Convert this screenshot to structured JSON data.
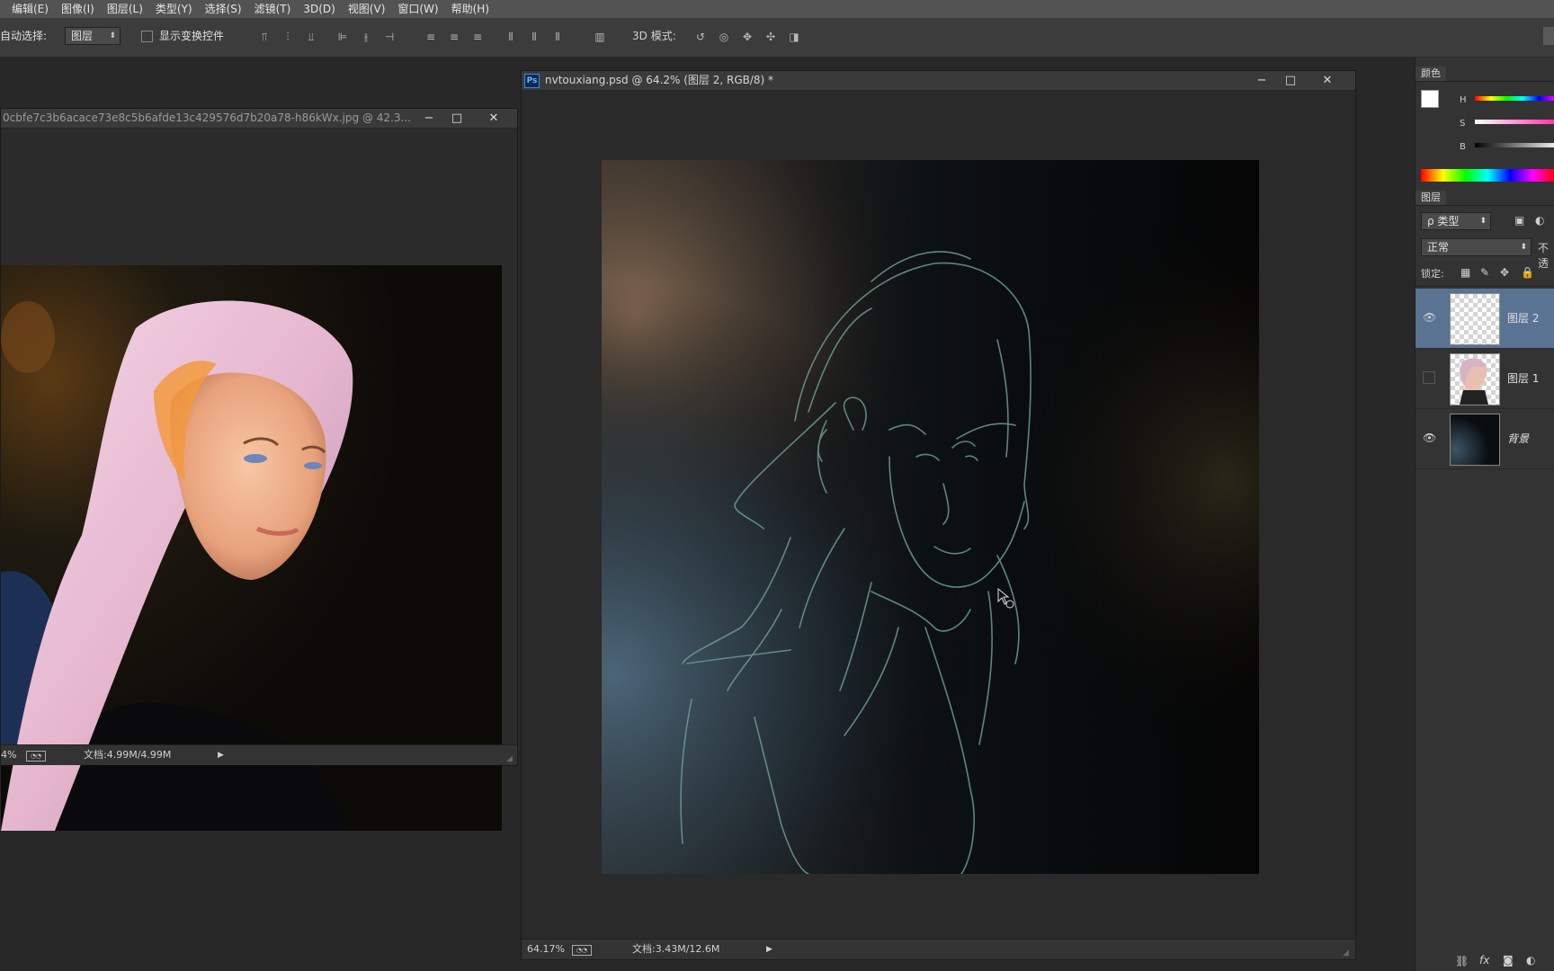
{
  "menu": [
    "编辑(E)",
    "图像(I)",
    "图层(L)",
    "类型(Y)",
    "选择(S)",
    "滤镜(T)",
    "3D(D)",
    "视图(V)",
    "窗口(W)",
    "帮助(H)"
  ],
  "options": {
    "auto_select_label": "自动选择:",
    "auto_select_value": "图层",
    "transform_label": "显示变换控件",
    "mode_3d_label": "3D 模式:"
  },
  "doc_ref": {
    "title": "0cbfe7c3b6acace73e8c5b6afde13c429576d7b20a78-h86kWx.jpg @ 42.3...",
    "zoom": "4%",
    "doc_info": "文档:4.99M/4.99M"
  },
  "doc_main": {
    "title": "nvtouxiang.psd @ 64.2% (图层 2, RGB/8) *",
    "ps_badge": "Ps",
    "zoom": "64.17%",
    "doc_info": "文档:3.43M/12.6M"
  },
  "window_buttons": {
    "minimize": "−",
    "maximize": "□",
    "close": "✕"
  },
  "color_panel": {
    "tab": "颜色",
    "h_label": "H",
    "s_label": "S",
    "b_label": "B"
  },
  "layers_panel": {
    "tab": "图层",
    "filter_value": "ρ 类型",
    "blend_mode": "正常",
    "opacity_label": "不透",
    "lock_label": "锁定:",
    "layers": [
      {
        "name": "图层 2",
        "visible": true,
        "selected": true
      },
      {
        "name": "图层 1",
        "visible": false,
        "selected": false
      },
      {
        "name": "背景",
        "visible": true,
        "selected": false
      }
    ]
  },
  "colors": {
    "accent_selected_layer": "#5b7393",
    "menubar": "#535353",
    "panel": "#333333"
  }
}
